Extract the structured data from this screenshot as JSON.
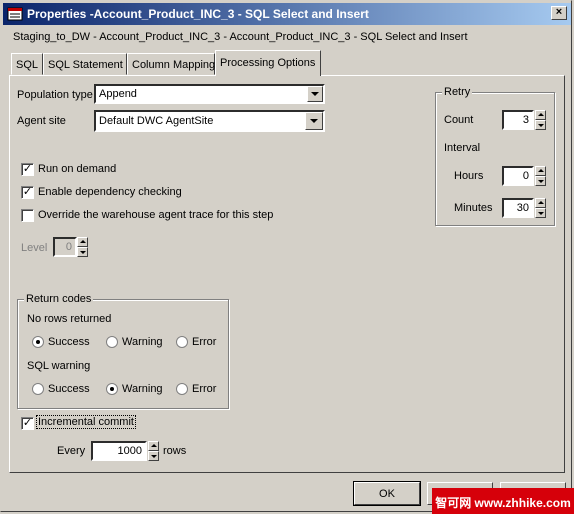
{
  "window": {
    "title": "Properties -Account_Product_INC_3 - SQL Select and Insert",
    "close_glyph": "×",
    "subtitle": "Staging_to_DW - Account_Product_INC_3 - Account_Product_INC_3 - SQL Select and Insert"
  },
  "tabs": [
    {
      "label": "SQL"
    },
    {
      "label": "SQL Statement"
    },
    {
      "label": "Column Mapping"
    },
    {
      "label": "Processing Options",
      "active": true
    }
  ],
  "form": {
    "population_type_label": "Population type",
    "population_type_value": "Append",
    "agent_site_label": "Agent site",
    "agent_site_value": "Default DWC AgentSite",
    "run_on_demand_label": "Run on demand",
    "run_on_demand_checked": true,
    "enable_dependency_label": "Enable dependency checking",
    "enable_dependency_checked": true,
    "override_trace_label": "Override the warehouse agent trace for this step",
    "override_trace_checked": false,
    "level_label": "Level",
    "level_value": "0"
  },
  "retry": {
    "group_label": "Retry",
    "count_label": "Count",
    "count_value": "3",
    "interval_label": "Interval",
    "hours_label": "Hours",
    "hours_value": "0",
    "minutes_label": "Minutes",
    "minutes_value": "30"
  },
  "return_codes": {
    "group_label": "Return codes",
    "no_rows_label": "No rows returned",
    "sql_warning_label": "SQL warning",
    "options": [
      "Success",
      "Warning",
      "Error"
    ],
    "no_rows_selected": "Success",
    "sql_warning_selected": "Warning"
  },
  "incremental": {
    "label": "Incremental commit",
    "checked": true,
    "every_label": "Every",
    "every_value": "1000",
    "rows_label": "rows"
  },
  "buttons": {
    "ok_label": "OK"
  },
  "watermark": {
    "text": "智可网 www.zhhike.com"
  },
  "colors": {
    "titlebar_start": "#0a246a",
    "titlebar_end": "#a6caf0",
    "dialog_bg": "#d4d0c8",
    "watermark_bg": "#d6000a"
  }
}
